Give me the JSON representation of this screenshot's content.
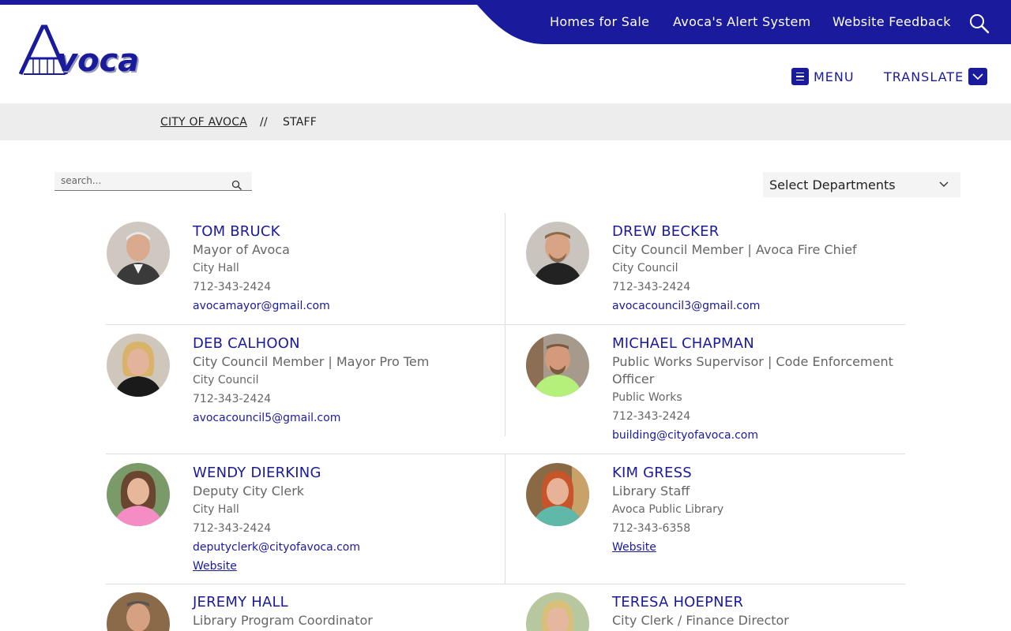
{
  "header": {
    "utility_links": [
      "Homes for Sale",
      "Avoca's Alert System",
      "Website Feedback"
    ],
    "logo_text": "Avoca",
    "menu_label": "MENU",
    "translate_label": "TRANSLATE"
  },
  "breadcrumb": {
    "items": [
      "CITY OF AVOCA",
      "STAFF"
    ],
    "separator": "//"
  },
  "filters": {
    "search_placeholder": "search...",
    "department_select": "Select Departments"
  },
  "colors": {
    "brand": "#1a1a9c",
    "muted_text": "#666666",
    "breadcrumb_bg": "#ededed"
  },
  "staff": [
    {
      "name": "TOM BRUCK",
      "title": "Mayor of Avoca",
      "department": "City Hall",
      "phone": "712-343-2424",
      "email": "avocamayor@gmail.com",
      "website": ""
    },
    {
      "name": "DREW BECKER",
      "title": "City Council Member | Avoca Fire Chief",
      "department": "City Council",
      "phone": "712-343-2424",
      "email": "avocacouncil3@gmail.com",
      "website": ""
    },
    {
      "name": "DEB CALHOON",
      "title": "City Council Member | Mayor Pro Tem",
      "department": "City Council",
      "phone": "712-343-2424",
      "email": "avocacouncil5@gmail.com",
      "website": ""
    },
    {
      "name": "MICHAEL CHAPMAN",
      "title": "Public Works Supervisor | Code Enforcement Officer",
      "department": "Public Works",
      "phone": "712-343-2424",
      "email": "building@cityofavoca.com",
      "website": ""
    },
    {
      "name": "WENDY DIERKING",
      "title": "Deputy City Clerk",
      "department": "City Hall",
      "phone": "712-343-2424",
      "email": "deputyclerk@cityofavoca.com",
      "website": "Website"
    },
    {
      "name": "KIM GRESS",
      "title": "Library Staff",
      "department": "Avoca Public Library",
      "phone": "712-343-6358",
      "email": "",
      "website": "Website"
    },
    {
      "name": "JEREMY HALL",
      "title": "Library Program Coordinator",
      "department": "",
      "phone": "",
      "email": "",
      "website": ""
    },
    {
      "name": "TERESA HOEPNER",
      "title": "City Clerk / Finance Director",
      "department": "",
      "phone": "",
      "email": "",
      "website": ""
    }
  ]
}
